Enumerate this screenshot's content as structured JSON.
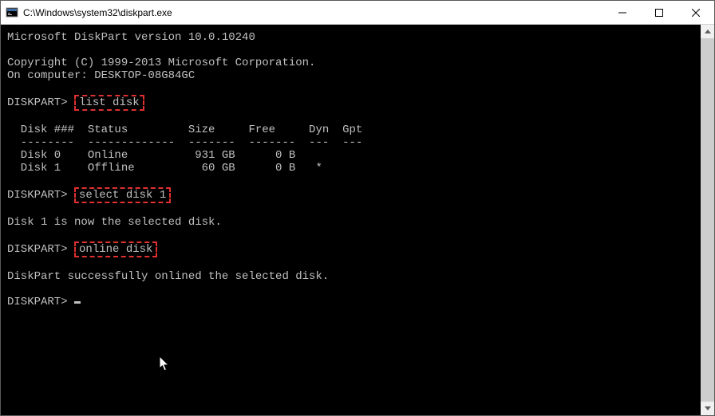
{
  "window": {
    "title": "C:\\Windows\\system32\\diskpart.exe"
  },
  "terminal": {
    "header_line1": "Microsoft DiskPart version 10.0.10240",
    "header_line2": "Copyright (C) 1999-2013 Microsoft Corporation.",
    "header_line3": "On computer: DESKTOP-08G84GC",
    "prompt": "DISKPART>",
    "cmd1": "list disk",
    "table_header": "  Disk ###  Status         Size     Free     Dyn  Gpt",
    "table_divider": "  --------  -------------  -------  -------  ---  ---",
    "table_row1": "  Disk 0    Online          931 GB      0 B",
    "table_row2": "  Disk 1    Offline          60 GB      0 B   *",
    "cmd2": "select disk 1",
    "response2": "Disk 1 is now the selected disk.",
    "cmd3": "online disk",
    "response3": "DiskPart successfully onlined the selected disk."
  }
}
